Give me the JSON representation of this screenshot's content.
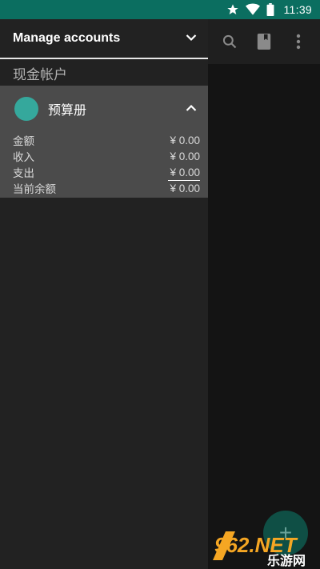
{
  "status_bar": {
    "time": "11:39",
    "icons": [
      "star-icon",
      "wifi-icon",
      "battery-icon"
    ],
    "background": "#0b6e60"
  },
  "app": {
    "toolbar_icons": [
      "search-icon",
      "bookmark-book-icon",
      "more-vert-icon"
    ],
    "fab_icon": "plus-icon",
    "accent": "#35a89c"
  },
  "drawer": {
    "header_title": "Manage accounts",
    "header_icon": "chevron-down-icon",
    "section_title": "现金帐户",
    "account": {
      "name": "预算册",
      "color": "#35a89c",
      "toggle_icon": "chevron-up-icon",
      "stats": [
        {
          "label": "金额",
          "value": "¥ 0.00"
        },
        {
          "label": "收入",
          "value": "¥ 0.00"
        },
        {
          "label": "支出",
          "value": "¥ 0.00"
        },
        {
          "label": "当前余额",
          "value": "¥ 0.00"
        }
      ]
    }
  },
  "watermark": {
    "brand": "962.NET",
    "subtitle": "乐游网"
  }
}
